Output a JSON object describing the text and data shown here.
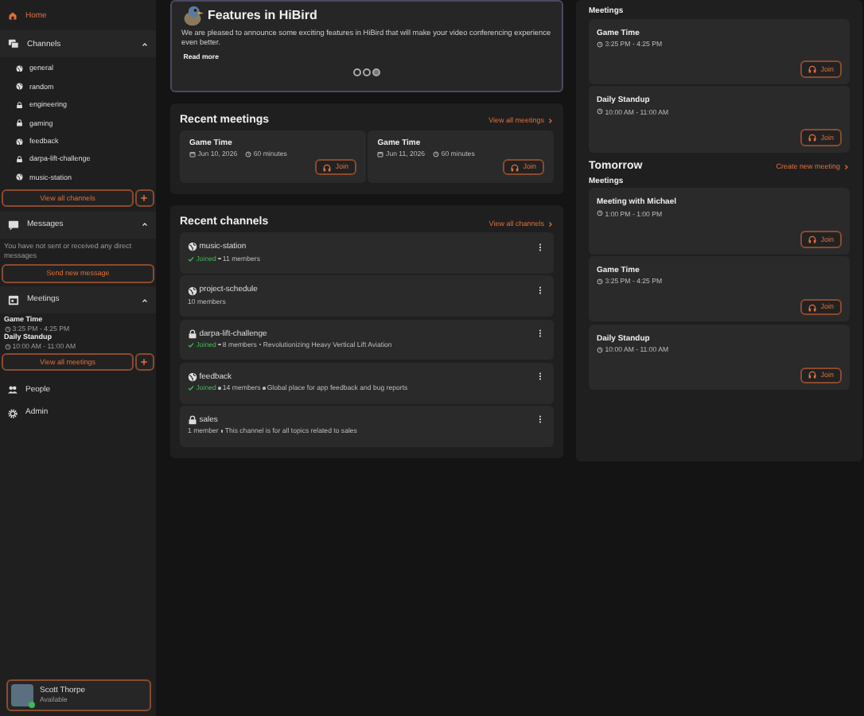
{
  "sidebar": {
    "top_nav": [
      {
        "label": "Home",
        "selected": true
      }
    ],
    "channels": {
      "title": "Channels",
      "expanded": true,
      "items": [
        {
          "name": "general",
          "kind": "public"
        },
        {
          "name": "random",
          "kind": "public"
        },
        {
          "name": "engineering",
          "kind": "private"
        },
        {
          "name": "gaming",
          "kind": "private"
        },
        {
          "name": "feedback",
          "kind": "public"
        },
        {
          "name": "darpa-lift-challenge",
          "kind": "private"
        },
        {
          "name": "music-station",
          "kind": "public"
        }
      ],
      "button": "View all channels"
    },
    "messages": {
      "title": "Messages",
      "expanded": true,
      "empty_text": "You have not sent or received any direct messages",
      "button": "Send new message"
    },
    "meetings": {
      "title": "Meetings",
      "expanded": true,
      "items": [
        {
          "title": "Game Time",
          "time": "3:25 PM - 4:25 PM"
        },
        {
          "title": "Daily Standup",
          "time": "10:00 AM - 11:00 AM"
        }
      ],
      "button": "View all meetings"
    },
    "bottom_nav": [
      {
        "label": "People",
        "selected": false
      },
      {
        "label": "Admin",
        "selected": false
      }
    ],
    "user": {
      "name": "Scott Thorpe",
      "status": "Available"
    }
  },
  "announcement": {
    "title": "Features in HiBird",
    "body": "We are pleased to announce some exciting features in HiBird that will make your video conferencing experience even better.",
    "button": "Read more",
    "dots": [
      {
        "selected": false
      },
      {
        "selected": false
      },
      {
        "selected": true
      }
    ]
  },
  "recent_meetings": {
    "title": "Recent meetings",
    "link": "View all meetings",
    "items": [
      {
        "title": "Game Time",
        "date": "Jun 10, 2026",
        "duration": "60 minutes",
        "button": "Join"
      },
      {
        "title": "Game Time",
        "date": "Jun 11, 2026",
        "duration": "60 minutes",
        "button": "Join"
      }
    ]
  },
  "recent_channels": {
    "title": "Recent channels",
    "link": "View all channels",
    "items": [
      {
        "name": "music-station",
        "kind": "public",
        "status": "Joined",
        "meta": [
          "11 members"
        ]
      },
      {
        "name": "project-schedule",
        "kind": "public",
        "meta": [
          "10 members"
        ]
      },
      {
        "name": "darpa-lift-challenge",
        "kind": "private",
        "status": "Joined",
        "meta": [
          "8 members",
          "Revolutionizing Heavy Vertical Lift Aviation"
        ]
      },
      {
        "name": "feedback",
        "kind": "public",
        "status": "Joined",
        "meta": [
          "14 members",
          "Global place for app feedback and bug reports"
        ]
      },
      {
        "name": "sales",
        "kind": "private",
        "meta": [
          "1 member",
          "This channel is for all topics related to sales"
        ]
      }
    ]
  },
  "today": {
    "subtitle": "Meetings",
    "items": [
      {
        "title": "Game Time",
        "time": "3:25 PM - 4:25 PM",
        "button": "Join"
      },
      {
        "title": "Daily Standup",
        "time": "10:00 AM - 11:00 AM",
        "button": "Join"
      }
    ]
  },
  "tomorrow": {
    "title": "Tomorrow",
    "link": "Create new meeting",
    "subtitle": "Meetings",
    "items": [
      {
        "title": "Meeting with Michael",
        "time": "1:00 PM - 1:00 PM",
        "button": "Join"
      },
      {
        "title": "Game Time",
        "time": "3:25 PM - 4:25 PM",
        "button": "Join"
      },
      {
        "title": "Daily Standup",
        "time": "10:00 AM - 11:00 AM",
        "button": "Join"
      }
    ]
  }
}
